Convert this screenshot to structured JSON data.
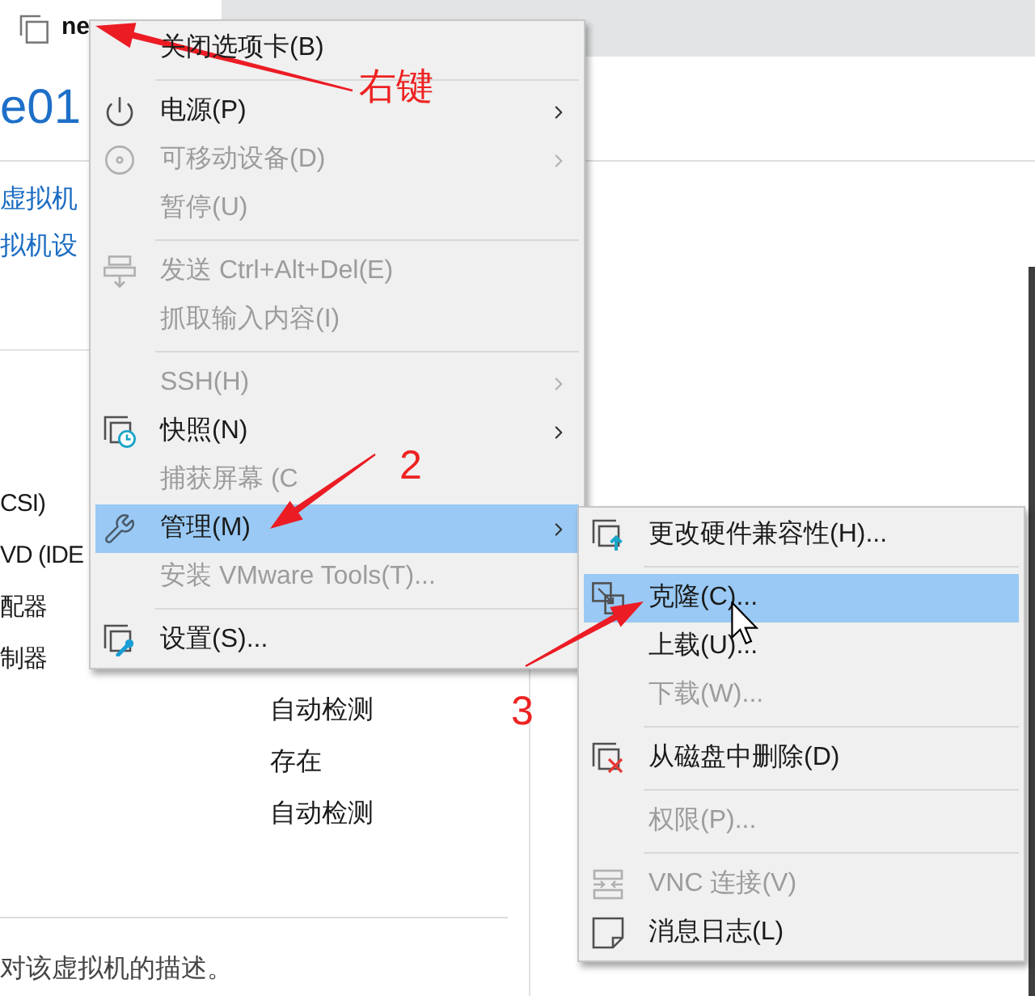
{
  "tab": {
    "title": "ne"
  },
  "vm": {
    "title": "e01",
    "links": [
      "虚拟机",
      "拟机设"
    ]
  },
  "devices": [
    {
      "name": "CSI)"
    },
    {
      "name": "VD (IDE"
    },
    {
      "name": "配器"
    },
    {
      "name": "制器"
    },
    {
      "value": "自动检测"
    },
    {
      "value": "存在"
    },
    {
      "value": "自动检测"
    }
  ],
  "description": "对该虚拟机的描述。",
  "context_menu": {
    "groups": [
      [
        {
          "label": "关闭选项卡(B)",
          "selected": false,
          "disabled": false,
          "submenu": false
        }
      ],
      [
        {
          "label": "电源(P)",
          "selected": false,
          "disabled": false,
          "submenu": true
        },
        {
          "label": "可移动设备(D)",
          "selected": false,
          "disabled": true,
          "submenu": true
        },
        {
          "label": "暂停(U)",
          "selected": false,
          "disabled": true,
          "submenu": false
        }
      ],
      [
        {
          "label": "发送 Ctrl+Alt+Del(E)",
          "selected": false,
          "disabled": true,
          "submenu": false
        },
        {
          "label": "抓取输入内容(I)",
          "selected": false,
          "disabled": true,
          "submenu": false
        }
      ],
      [
        {
          "label": "SSH(H)",
          "selected": false,
          "disabled": true,
          "submenu": true
        },
        {
          "label": "快照(N)",
          "selected": false,
          "disabled": false,
          "submenu": true
        },
        {
          "label": "捕获屏幕 (C",
          "selected": false,
          "disabled": true,
          "submenu": false
        },
        {
          "label": "管理(M)",
          "selected": true,
          "disabled": false,
          "submenu": true
        },
        {
          "label": "安装 VMware Tools(T)...",
          "selected": false,
          "disabled": true,
          "submenu": false
        }
      ],
      [
        {
          "label": "设置(S)...",
          "selected": false,
          "disabled": false,
          "submenu": false
        }
      ]
    ]
  },
  "submenu": {
    "groups": [
      [
        {
          "label": "更改硬件兼容性(H)...",
          "selected": false,
          "disabled": false
        }
      ],
      [
        {
          "label": "克隆(C)...",
          "selected": true,
          "disabled": false
        },
        {
          "label": "上载(U)...",
          "selected": false,
          "disabled": false
        },
        {
          "label": "下载(W)...",
          "selected": false,
          "disabled": true
        }
      ],
      [
        {
          "label": "从磁盘中删除(D)",
          "selected": false,
          "disabled": false
        }
      ],
      [
        {
          "label": "权限(P)...",
          "selected": false,
          "disabled": true
        }
      ],
      [
        {
          "label": "VNC 连接(V)",
          "selected": false,
          "disabled": true
        },
        {
          "label": "消息日志(L)",
          "selected": false,
          "disabled": false
        }
      ]
    ]
  },
  "annotations": [
    {
      "text": "右键"
    },
    {
      "text": "2"
    },
    {
      "text": "3"
    }
  ]
}
